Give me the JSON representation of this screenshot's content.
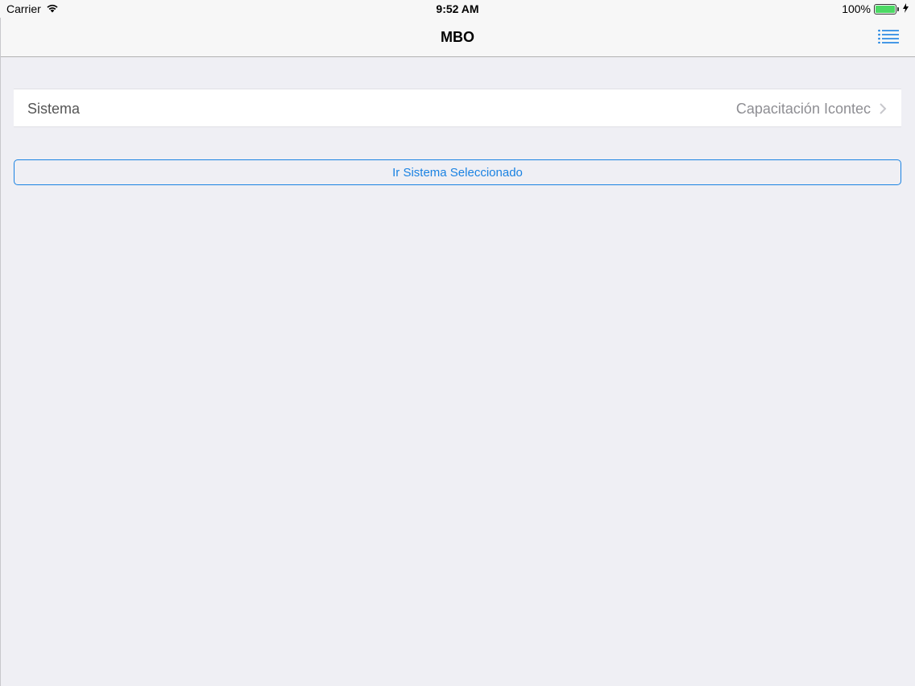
{
  "status_bar": {
    "carrier": "Carrier",
    "time": "9:52 AM",
    "battery_percent": "100%",
    "battery_level": 1.0,
    "battery_color": "#4cd964"
  },
  "nav_bar": {
    "title": "MBO",
    "menu_icon": "list-icon",
    "accent_color": "#1a82e2"
  },
  "system_row": {
    "label": "Sistema",
    "value": "Capacitación Icontec",
    "icon": "chevron-right-icon"
  },
  "go_button": {
    "label": "Ir Sistema Seleccionado"
  }
}
